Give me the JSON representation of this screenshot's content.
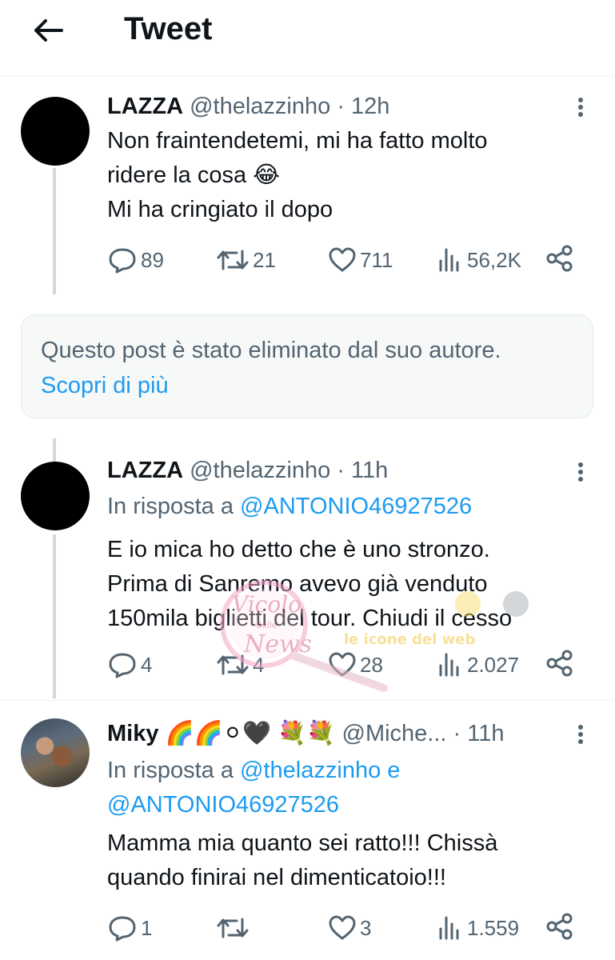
{
  "header": {
    "title": "Tweet",
    "back_icon": "arrow-left-icon"
  },
  "tweets": [
    {
      "name": "LAZZA",
      "handle": "@thelazzinho",
      "dot": "·",
      "time": "12h",
      "text_lines": [
        "Non fraintendetemi, mi ha fatto molto",
        "ridere la cosa 😂",
        "Mi ha cringiato il dopo"
      ],
      "replies": "89",
      "retweets": "21",
      "likes": "711",
      "views": "56,2K"
    },
    {
      "name": "LAZZA",
      "handle": "@thelazzinho",
      "dot": "·",
      "time": "11h",
      "reply_prefix": "In risposta a",
      "reply_mention": "@ANTONIO46927526",
      "text_lines": [
        "E io mica ho detto che è uno stronzo.",
        "Prima di Sanremo avevo già venduto",
        "150mila biglietti del tour. Chiudi il cesso"
      ],
      "replies": "4",
      "retweets": "4",
      "likes": "28",
      "views": "2.027"
    },
    {
      "name": "Miky 🌈🌈⚪🖤 💐💐",
      "handle": "@Miche...",
      "dot": "·",
      "time": "11h",
      "reply_prefix": "In risposta a",
      "reply_mention": "@thelazzinho",
      "reply_conj": "e",
      "reply_mention2": "@ANTONIO46927526",
      "text_lines": [
        "Mamma mia quanto sei ratto!!! Chissà",
        "quando finirai nel dimenticatoio!!!"
      ],
      "replies": "1",
      "retweets": "",
      "likes": "3",
      "views": "1.559"
    }
  ],
  "deleted": {
    "message": "Questo post è stato eliminato dal suo autore.",
    "link": "Scopri di più"
  },
  "watermark": {
    "text1": "Vicolo",
    "text2": "delle",
    "text3": "News",
    "text4": "le icone del web"
  },
  "colors": {
    "accent": "#1d9bf0",
    "text": "#0f1419",
    "muted": "#536471",
    "line": "#cfd9de"
  }
}
